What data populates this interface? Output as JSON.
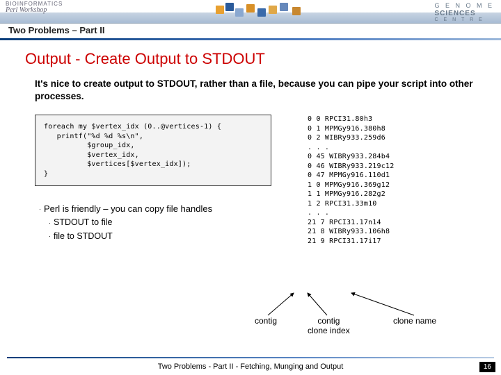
{
  "header": {
    "left_logo_line1": "BIOINFORMATICS",
    "left_logo_line2": "Perl Workshop",
    "right_logo_line1": "G E N O M E",
    "right_logo_line2": "SCIENCES",
    "right_logo_line3": "C E N T R E"
  },
  "subtitle": "Two Problems – Part II",
  "title": "Output - Create Output to STDOUT",
  "intro": "It's nice to create output to STDOUT, rather than a file, because you can pipe your script into other processes.",
  "code": "foreach my $vertex_idx (0..@vertices-1) {\n   printf(\"%d %d %s\\n\",\n          $group_idx,\n          $vertex_idx,\n          $vertices[$vertex_idx]);\n}",
  "note_main": "Perl is friendly – you can copy file handles",
  "note_sub1": "STDOUT to file",
  "note_sub2": "file to STDOUT",
  "output": "0 0 RPCI31.80h3\n0 1 MPMGy916.380h8\n0 2 WIBRy933.259d6\n. . .\n0 45 WIBRy933.284b4\n0 46 WIBRy933.219c12\n0 47 MPMGy916.110d1\n1 0 MPMGy916.369g12\n1 1 MPMGy916.282g2\n1 2 RPCI31.33m10\n. . .\n21 7 RPCI31.17n14\n21 8 WIBRy933.106h8\n21 9 RPCI31.17i17",
  "annotations": {
    "label1": "contig",
    "label2_line1": "contig",
    "label2_line2": "clone index",
    "label3": "clone name"
  },
  "footer": "Two Problems - Part II - Fetching, Munging and Output",
  "page": "16"
}
